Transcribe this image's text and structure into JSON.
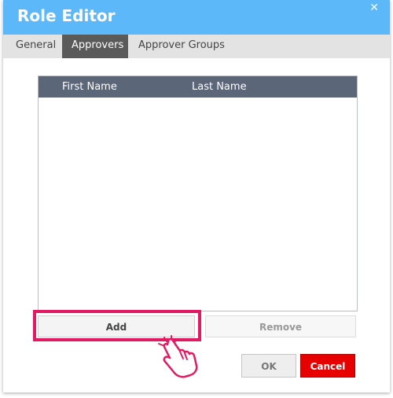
{
  "dialog": {
    "title": "Role Editor",
    "close_icon": "close-icon",
    "tabs": [
      {
        "label": "General",
        "active": false
      },
      {
        "label": "Approvers",
        "active": true
      },
      {
        "label": "Approver Groups",
        "active": false
      }
    ],
    "grid": {
      "columns": [
        "First Name",
        "Last Name"
      ],
      "rows": []
    },
    "buttons": {
      "add": "Add",
      "remove": "Remove",
      "ok": "OK",
      "cancel": "Cancel"
    },
    "colors": {
      "titlebar": "#5cb8f8",
      "active_tab": "#5a5a5a",
      "grid_header": "#5c6679",
      "highlight": "#e21a62",
      "cancel": "#e60000"
    },
    "pointer_icon": "hand-pointer-icon"
  }
}
